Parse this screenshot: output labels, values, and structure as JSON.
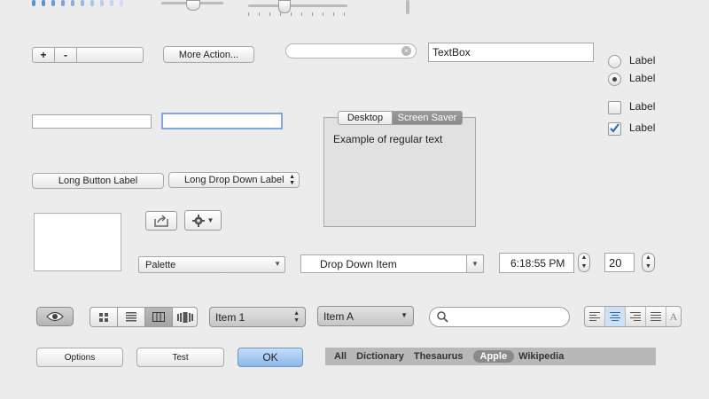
{
  "segment_plus_minus": {
    "plus": "+",
    "minus": "-"
  },
  "buttons": {
    "more_action": "More Action...",
    "long_button": "Long Button Label",
    "long_dropdown": "Long Drop Down Label",
    "options": "Options",
    "test": "Test",
    "ok": "OK"
  },
  "textbox": {
    "value": "TextBox"
  },
  "radios": [
    {
      "label": "Label",
      "checked": false
    },
    {
      "label": "Label",
      "checked": true
    }
  ],
  "checkboxes": [
    {
      "label": "Label",
      "checked": false
    },
    {
      "label": "Label",
      "checked": true
    }
  ],
  "tab_view": {
    "tabs": [
      {
        "label": "Desktop",
        "selected": false
      },
      {
        "label": "Screen Saver",
        "selected": true
      }
    ],
    "content": "Example of regular text"
  },
  "dropdowns": {
    "palette": "Palette",
    "drop_down_item": "Drop Down Item",
    "item_1": "Item 1",
    "item_a": "Item A"
  },
  "time_picker": {
    "value": "6:18:55 PM"
  },
  "stepper": {
    "value": "20"
  },
  "scope_bar": {
    "items": [
      {
        "label": "All",
        "selected": false
      },
      {
        "label": "Dictionary",
        "selected": false
      },
      {
        "label": "Thesaurus",
        "selected": false
      },
      {
        "label": "Apple",
        "selected": true
      },
      {
        "label": "Wikipedia",
        "selected": false
      }
    ]
  },
  "colors": {
    "accent_blue": "#5b8fd6",
    "ok_button": "#9cc4ef",
    "scope_bar_bg": "#b8b8b8",
    "text_dark": "#222222"
  },
  "icons": [
    "share-icon",
    "gear-icon",
    "eye-icon",
    "icon-view-icon",
    "list-view-icon",
    "column-view-icon",
    "coverflow-view-icon",
    "search-icon",
    "align-left-icon",
    "align-center-icon",
    "align-right-icon",
    "align-justify-icon",
    "text-style-icon",
    "clear-icon"
  ]
}
